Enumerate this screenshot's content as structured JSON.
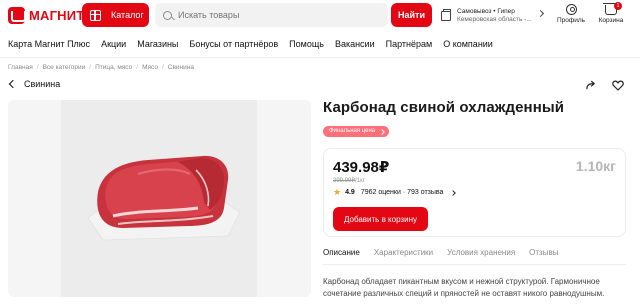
{
  "header": {
    "logo_text": "МАГНИТ",
    "catalog_label": "Каталог",
    "search_placeholder": "Искать товары",
    "find_label": "Найти",
    "store_line1": "Самовывоз • Гипер",
    "store_line2": "Кемеровская область -...",
    "profile_label": "Профиль",
    "cart_label": "Корзина",
    "cart_count": "1",
    "brand_color": "#e30613"
  },
  "nav": {
    "items": [
      "Карта Магнит Плюс",
      "Акции",
      "Магазины",
      "Бонусы от партнёров",
      "Помощь",
      "Вакансии",
      "Партнёрам",
      "О компании"
    ]
  },
  "breadcrumb": [
    "Главная",
    "Все категории",
    "Птица, мясо",
    "Мясо",
    "Свинина"
  ],
  "back_label": "Свинина",
  "product": {
    "title": "Карбонад свиной охлажденный",
    "badge": "Финальная цена",
    "price": "439.98₽",
    "old_price": "399.99₽",
    "old_price_unit": "/1кг",
    "weight": "1.10кг",
    "rating_score": "4.9",
    "rating_count": "7962 оценки · 793 отзыва",
    "add_to_cart": "Добавить в корзину"
  },
  "tabs": [
    "Описание",
    "Характеристики",
    "Условия хранения",
    "Отзывы"
  ],
  "description": "Карбонад обладает пикантным вкусом и нежной структурой. Гармоничное сочетание различных специй и пряностей не оставят никого равнодушным."
}
